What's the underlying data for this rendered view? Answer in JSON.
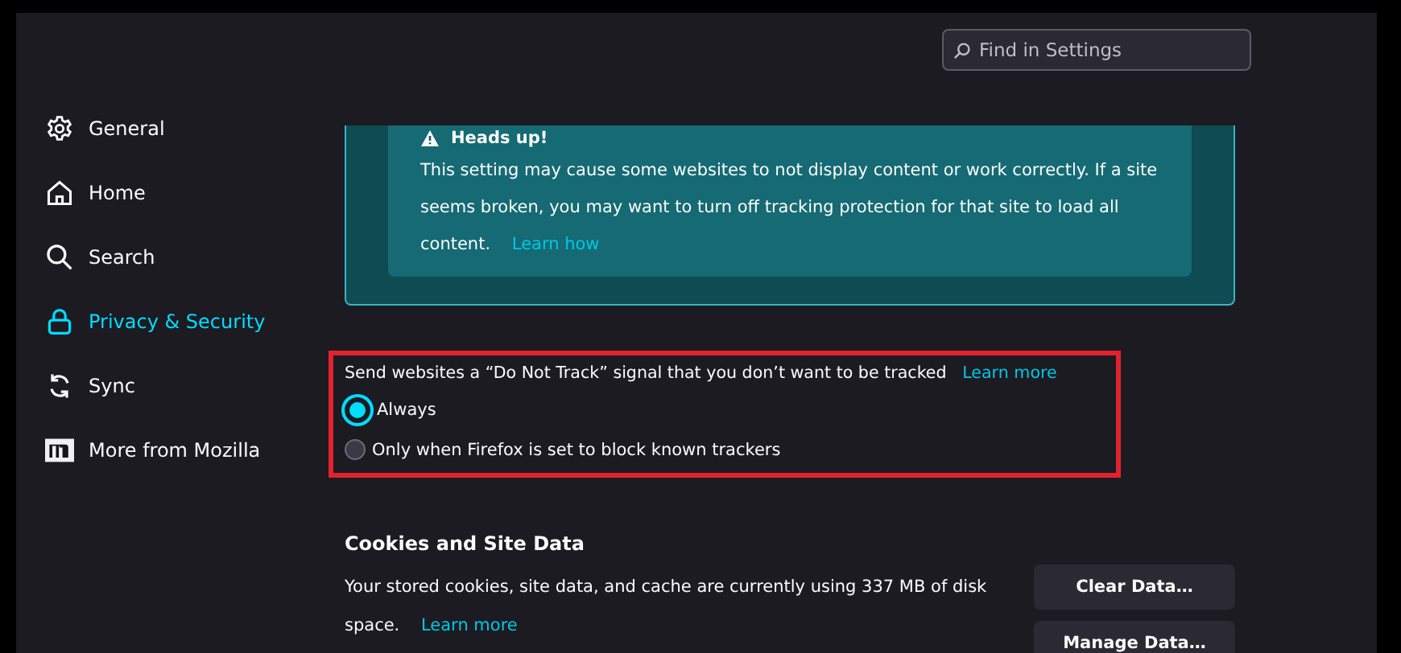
{
  "search": {
    "placeholder": "Find in Settings"
  },
  "sidebar": {
    "items": [
      {
        "label": "General",
        "selected": false
      },
      {
        "label": "Home",
        "selected": false
      },
      {
        "label": "Search",
        "selected": false
      },
      {
        "label": "Privacy & Security",
        "selected": true
      },
      {
        "label": "Sync",
        "selected": false
      },
      {
        "label": "More from Mozilla",
        "selected": false
      }
    ]
  },
  "warning": {
    "title": "Heads up!",
    "text": "This setting may cause some websites to not display content or work correctly. If a site seems broken, you may want to turn off tracking protection for that site to load all content.",
    "link": "Learn how"
  },
  "do_not_track": {
    "label": "Send websites a “Do Not Track” signal that you don’t want to be tracked",
    "link": "Learn more",
    "highlighted": true,
    "options": [
      {
        "label": "Always",
        "selected": true
      },
      {
        "label": "Only when Firefox is set to block known trackers",
        "selected": false
      }
    ]
  },
  "cookies": {
    "title": "Cookies and Site Data",
    "text": "Your stored cookies, site data, and cache are currently using 337 MB of disk space.",
    "link": "Learn more",
    "buttons": [
      "Clear Data…",
      "Manage Data…"
    ]
  }
}
